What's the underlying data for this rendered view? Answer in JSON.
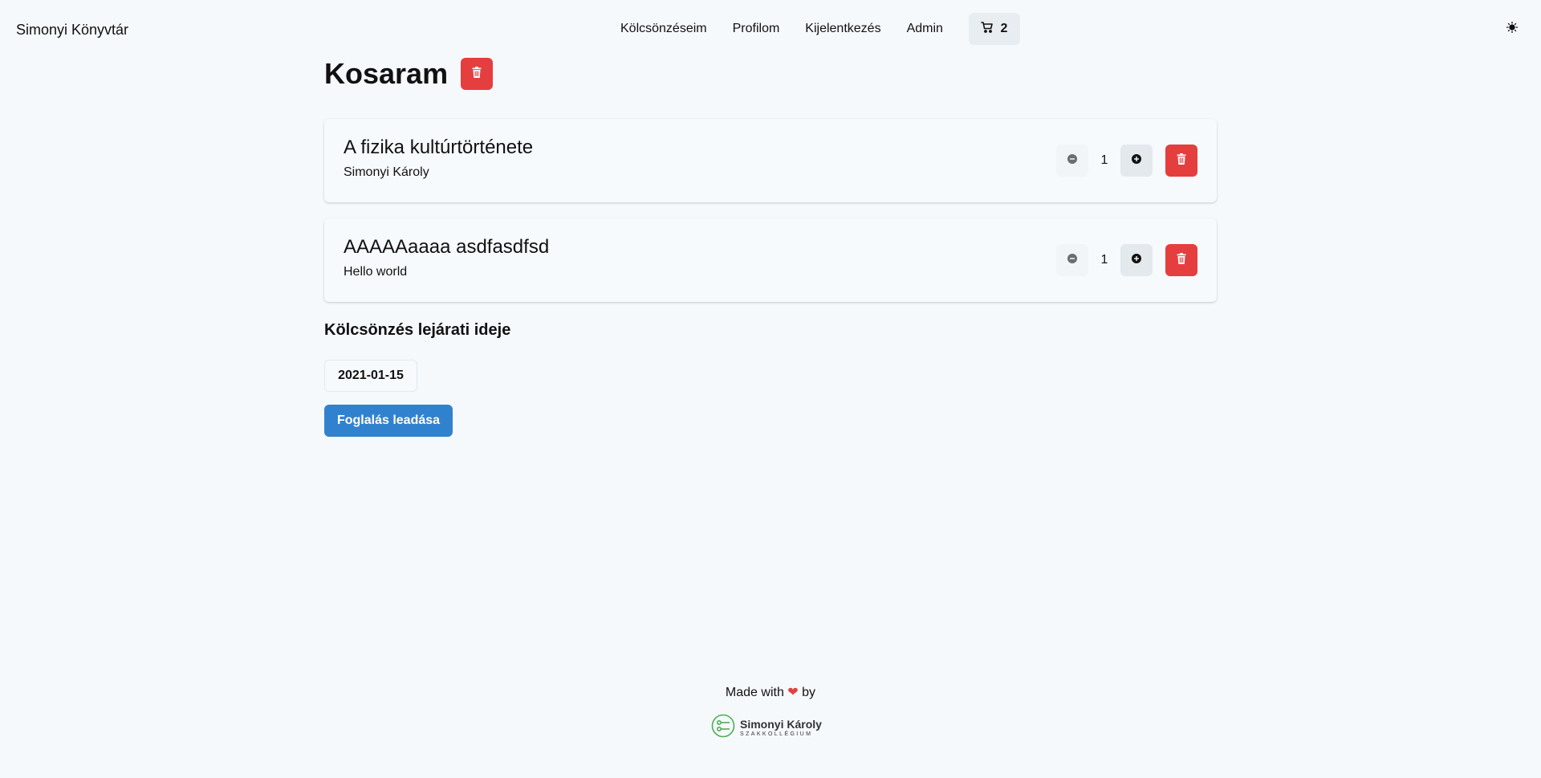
{
  "navbar": {
    "brand": "Simonyi Könyvtár",
    "links": [
      "Kölcsönzéseim",
      "Profilom",
      "Kijelentkezés",
      "Admin"
    ],
    "cart_count": "2",
    "cart_icon": "cart-icon",
    "theme_icon": "sun-icon"
  },
  "page": {
    "title": "Kosaram"
  },
  "cart_items": [
    {
      "title": "A fizika kultúrtörténete",
      "author": "Simonyi Károly",
      "quantity": "1"
    },
    {
      "title": "AAAAAaaaa asdfasdfsd",
      "author": "Hello world",
      "quantity": "1"
    }
  ],
  "due_date": {
    "heading": "Kölcsönzés lejárati ideje",
    "value": "2021-01-15"
  },
  "submit_label": "Foglalás leadása",
  "footer": {
    "made_with": "Made with",
    "by": "by",
    "logo_name": "Simonyi Károly",
    "logo_sub": "SZAKKOLLÉGIUM"
  },
  "colors": {
    "danger": "#e53e3e",
    "primary": "#3182ce",
    "background": "#f5f9fc",
    "logo_green": "#4caf50"
  }
}
